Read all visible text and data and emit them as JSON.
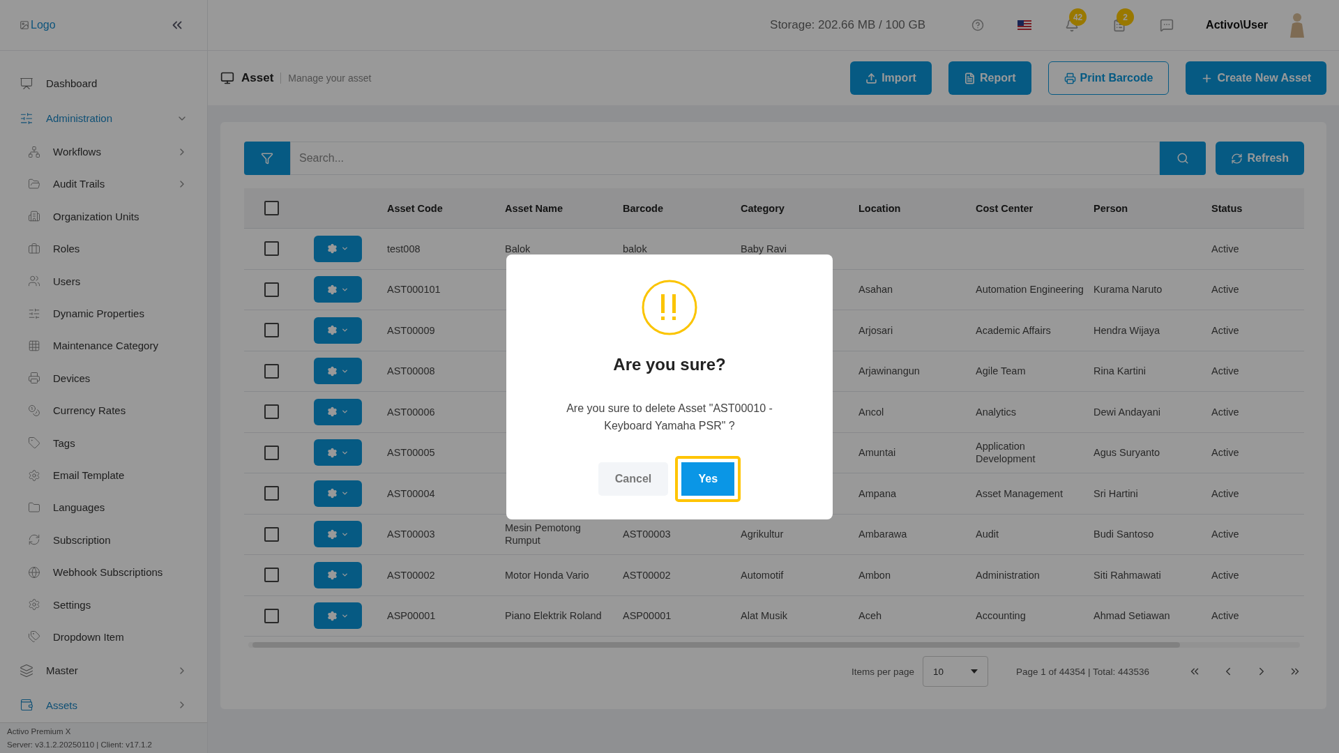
{
  "header": {
    "logo_alt": "Logo",
    "storage": "Storage: 202.66 MB / 100 GB",
    "notifications": "42",
    "tasks": "2",
    "user": "Activo\\User"
  },
  "sidebar": {
    "items": [
      {
        "label": "Dashboard",
        "selected": false
      },
      {
        "label": "Administration",
        "selected": true,
        "expanded": true,
        "children": [
          {
            "label": "Workflows",
            "selected": false,
            "expanded": false
          },
          {
            "label": "Audit Trails",
            "selected": false,
            "expanded": false
          },
          {
            "label": "Organization Units",
            "selected": false
          },
          {
            "label": "Roles",
            "selected": false
          },
          {
            "label": "Users",
            "selected": false
          },
          {
            "label": "Dynamic Properties",
            "selected": false
          },
          {
            "label": "Maintenance Category",
            "selected": false
          },
          {
            "label": "Devices",
            "selected": false
          },
          {
            "label": "Currency Rates",
            "selected": false
          },
          {
            "label": "Tags",
            "selected": false
          },
          {
            "label": "Email Template",
            "selected": false
          },
          {
            "label": "Languages",
            "selected": false
          },
          {
            "label": "Subscription",
            "selected": false
          },
          {
            "label": "Webhook Subscriptions",
            "selected": false
          },
          {
            "label": "Settings",
            "selected": false
          },
          {
            "label": "Dropdown Item",
            "selected": false
          }
        ]
      },
      {
        "label": "Master",
        "selected": false,
        "expanded": false
      },
      {
        "label": "Assets",
        "selected": true,
        "expanded": false
      }
    ],
    "footer": [
      "Activo Premium X",
      "Server: v3.1.2.20250110 | Client: v17.1.2"
    ]
  },
  "page": {
    "title": "Asset",
    "subtitle": "Manage your asset",
    "buttons": [
      {
        "label": "Import",
        "kind": "solid"
      },
      {
        "label": "Report",
        "kind": "solid"
      },
      {
        "label": "Print Barcode",
        "kind": "outline"
      },
      {
        "label": "Create New Asset",
        "kind": "solid"
      }
    ]
  },
  "search": {
    "placeholder": "Search...",
    "refresh": "Refresh"
  },
  "table": {
    "all_checked": false,
    "columns": [
      "Asset Code",
      "Asset Name",
      "Barcode",
      "Category",
      "Location",
      "Cost Center",
      "Person",
      "Status"
    ],
    "rows": [
      {
        "checked": false,
        "cells": [
          "test008",
          "Balok",
          "balok",
          "Baby Ravi",
          null,
          null,
          null,
          "Active"
        ]
      },
      {
        "checked": false,
        "cells": [
          "AST000101",
          null,
          null,
          null,
          "Asahan",
          "Automation Engineering",
          "Kurama Naruto",
          "Active"
        ]
      },
      {
        "checked": false,
        "cells": [
          "AST00009",
          null,
          null,
          null,
          "Arjosari",
          "Academic Affairs",
          "Hendra Wijaya",
          "Active"
        ]
      },
      {
        "checked": false,
        "cells": [
          "AST00008",
          null,
          null,
          null,
          "Arjawinangun",
          "Agile Team",
          "Rina Kartini",
          "Active"
        ]
      },
      {
        "checked": false,
        "cells": [
          "AST00006",
          null,
          null,
          null,
          "Ancol",
          "Analytics",
          "Dewi Andayani",
          "Active"
        ]
      },
      {
        "checked": false,
        "cells": [
          "AST00005",
          null,
          null,
          null,
          "Amuntai",
          "Application Development",
          "Agus Suryanto",
          "Active"
        ]
      },
      {
        "checked": false,
        "cells": [
          "AST00004",
          null,
          null,
          null,
          "Ampana",
          "Asset Management",
          "Sri Hartini",
          "Active"
        ]
      },
      {
        "checked": false,
        "cells": [
          "AST00003",
          "Mesin Pemotong Rumput",
          "AST00003",
          "Agrikultur",
          "Ambarawa",
          "Audit",
          "Budi Santoso",
          "Active"
        ]
      },
      {
        "checked": false,
        "cells": [
          "AST00002",
          "Motor Honda Vario",
          "AST00002",
          "Automotif",
          "Ambon",
          "Administration",
          "Siti Rahmawati",
          "Active"
        ]
      },
      {
        "checked": false,
        "cells": [
          "ASP00001",
          "Piano Elektrik Roland",
          "ASP00001",
          "Alat Musik",
          "Aceh",
          "Accounting",
          "Ahmad Setiawan",
          "Active"
        ]
      }
    ]
  },
  "pagination": {
    "items_per_page_label": "Items per page",
    "items_per_page": "10",
    "summary": "Page 1 of 44354 | Total: 443536"
  },
  "dialog": {
    "title": "Are you sure?",
    "message": "Are you sure to delete Asset \"AST00010  - Keyboard Yamaha PSR\" ?",
    "buttons": [
      {
        "label": "Cancel",
        "kind": "cancel",
        "focused": false
      },
      {
        "label": "Yes",
        "kind": "confirm",
        "focused": true
      }
    ]
  }
}
